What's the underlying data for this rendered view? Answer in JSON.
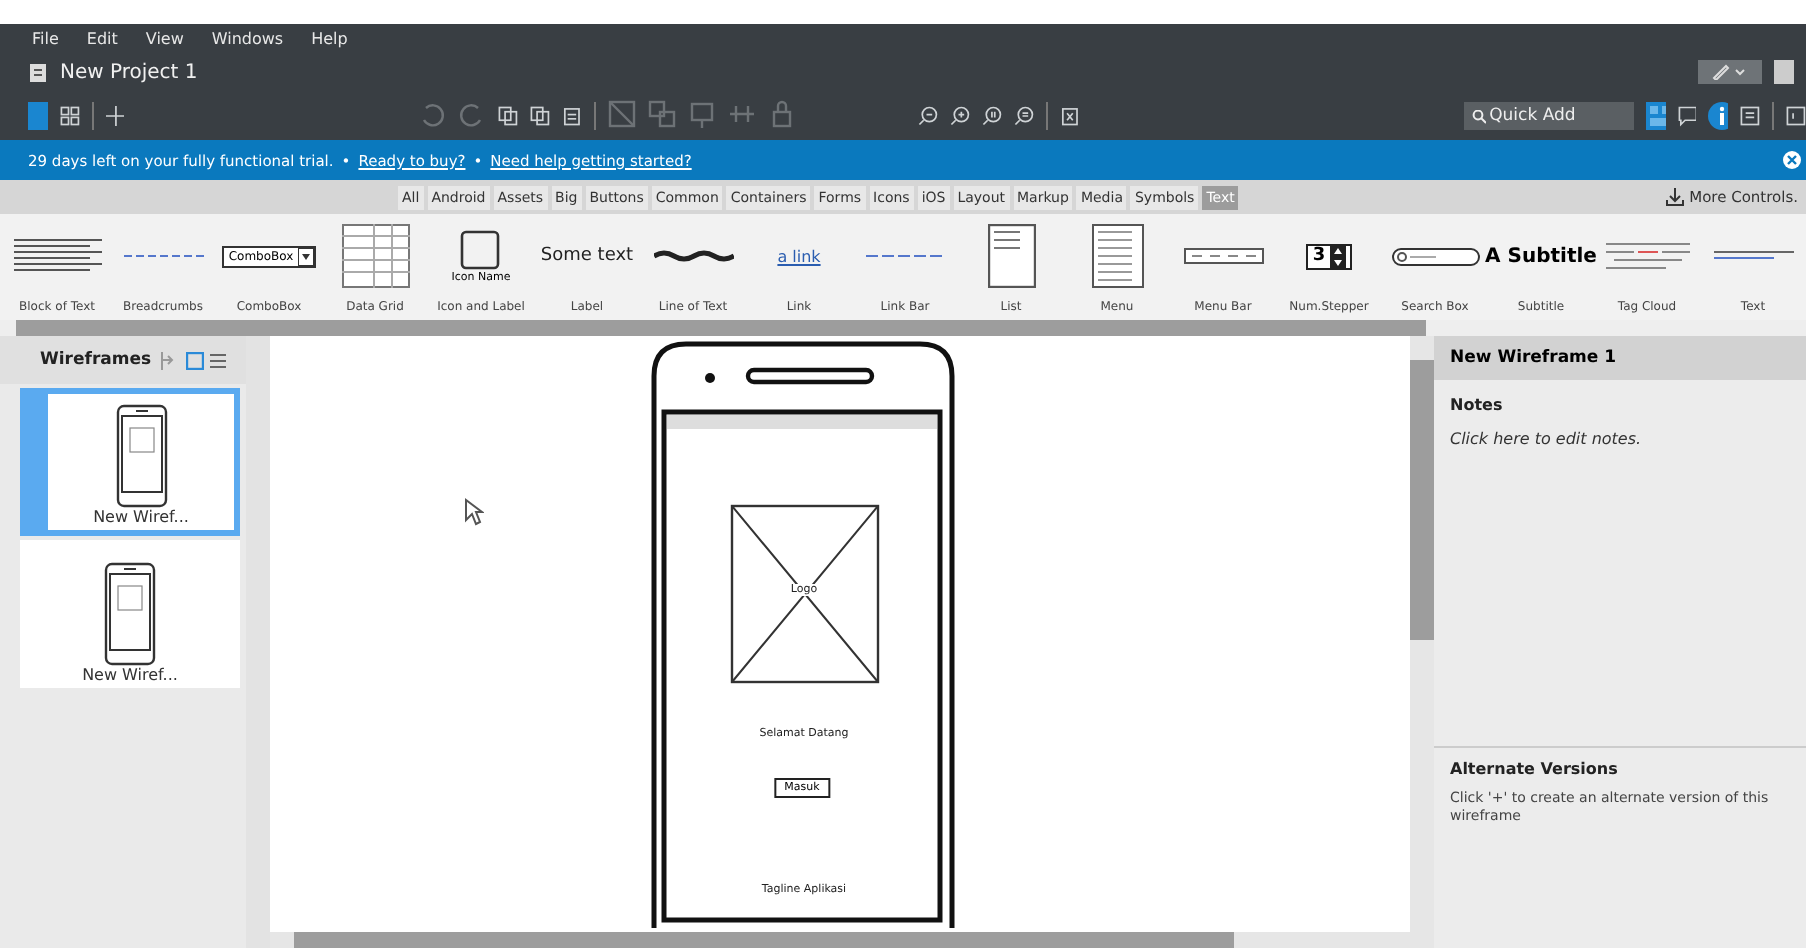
{
  "menu": [
    "File",
    "Edit",
    "View",
    "Windows",
    "Help"
  ],
  "project_title": "New Project 1",
  "quick_add": {
    "placeholder": "Quick Add"
  },
  "trial_bar": {
    "message": "29 days left on your fully functional trial.",
    "separator": "•",
    "links": [
      "Ready to buy?",
      "Need help getting started?"
    ]
  },
  "categories": [
    {
      "label": "All",
      "selected": false
    },
    {
      "label": "Android",
      "selected": false
    },
    {
      "label": "Assets",
      "selected": false
    },
    {
      "label": "Big",
      "selected": false
    },
    {
      "label": "Buttons",
      "selected": false
    },
    {
      "label": "Common",
      "selected": false
    },
    {
      "label": "Containers",
      "selected": false
    },
    {
      "label": "Forms",
      "selected": false
    },
    {
      "label": "Icons",
      "selected": false
    },
    {
      "label": "iOS",
      "selected": false
    },
    {
      "label": "Layout",
      "selected": false
    },
    {
      "label": "Markup",
      "selected": false
    },
    {
      "label": "Media",
      "selected": false
    },
    {
      "label": "Symbols",
      "selected": false
    },
    {
      "label": "Text",
      "selected": true
    }
  ],
  "more_controls": "More Controls.",
  "gallery": [
    {
      "label": "Block of Text",
      "kind": "block"
    },
    {
      "label": "Breadcrumbs",
      "kind": "breadcrumbs"
    },
    {
      "label": "ComboBox",
      "kind": "combobox",
      "preview": "ComboBox"
    },
    {
      "label": "Data Grid",
      "kind": "datagrid"
    },
    {
      "label": "Icon and Label",
      "kind": "iconlabel",
      "preview": "Icon Name"
    },
    {
      "label": "Label",
      "kind": "label",
      "preview": "Some text"
    },
    {
      "label": "Line of Text",
      "kind": "linetext"
    },
    {
      "label": "Link",
      "kind": "link",
      "preview": "a link"
    },
    {
      "label": "Link Bar",
      "kind": "linkbar"
    },
    {
      "label": "List",
      "kind": "list"
    },
    {
      "label": "Menu",
      "kind": "menu"
    },
    {
      "label": "Menu Bar",
      "kind": "menubar"
    },
    {
      "label": "Num.Stepper",
      "kind": "stepper",
      "preview": "3"
    },
    {
      "label": "Search Box",
      "kind": "searchbox"
    },
    {
      "label": "Subtitle",
      "kind": "subtitle",
      "preview": "A Subtitle"
    },
    {
      "label": "Tag Cloud",
      "kind": "tagcloud"
    },
    {
      "label": "Text",
      "kind": "text"
    }
  ],
  "wireframes": {
    "title": "Wireframes",
    "items": [
      {
        "label": "New Wiref...",
        "selected": true
      },
      {
        "label": "New Wiref...",
        "selected": false
      }
    ]
  },
  "mockup": {
    "image_label": "Logo",
    "heading": "Selamat Datang",
    "button": "Masuk",
    "tagline": "Tagline Aplikasi"
  },
  "inspector": {
    "title": "New Wireframe 1",
    "notes_heading": "Notes",
    "notes_placeholder": "Click here to edit notes.",
    "alternates_heading": "Alternate Versions",
    "alternates_text": "Click '+' to create an alternate version of this wireframe"
  }
}
